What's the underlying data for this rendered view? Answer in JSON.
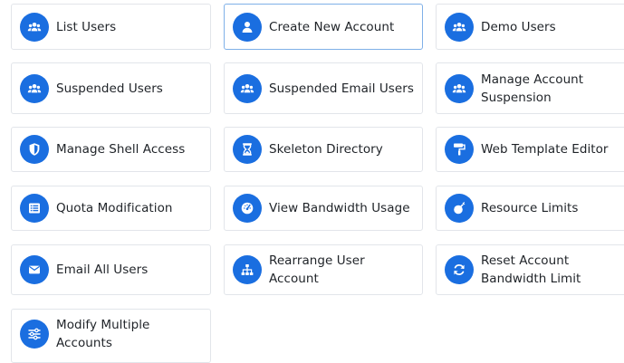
{
  "tiles": [
    {
      "label": "List Users",
      "icon": "users-icon"
    },
    {
      "label": "Create New Account",
      "icon": "user-icon"
    },
    {
      "label": "Demo Users",
      "icon": "users-icon"
    },
    {
      "label": "Suspended Users",
      "icon": "users-icon"
    },
    {
      "label": "Suspended Email Users",
      "icon": "users-icon"
    },
    {
      "label": "Manage Account Suspension",
      "icon": "users-icon"
    },
    {
      "label": "Manage Shell Access",
      "icon": "shield-icon"
    },
    {
      "label": "Skeleton Directory",
      "icon": "hourglass-icon"
    },
    {
      "label": "Web Template Editor",
      "icon": "paint-roller-icon"
    },
    {
      "label": "Quota Modification",
      "icon": "list-icon"
    },
    {
      "label": "View Bandwidth Usage",
      "icon": "gauge-icon"
    },
    {
      "label": "Resource Limits",
      "icon": "bomb-icon"
    },
    {
      "label": "Email All Users",
      "icon": "envelope-icon"
    },
    {
      "label": "Rearrange User Account",
      "icon": "sitemap-icon"
    },
    {
      "label": "Reset Account Bandwidth Limit",
      "icon": "refresh-icon"
    },
    {
      "label": "Modify Multiple Accounts",
      "icon": "sliders-icon"
    }
  ],
  "colors": {
    "accent": "#1a6ee0",
    "active_border": "#7fb0e8",
    "border": "#e2e5ea",
    "text": "#1f2328"
  }
}
